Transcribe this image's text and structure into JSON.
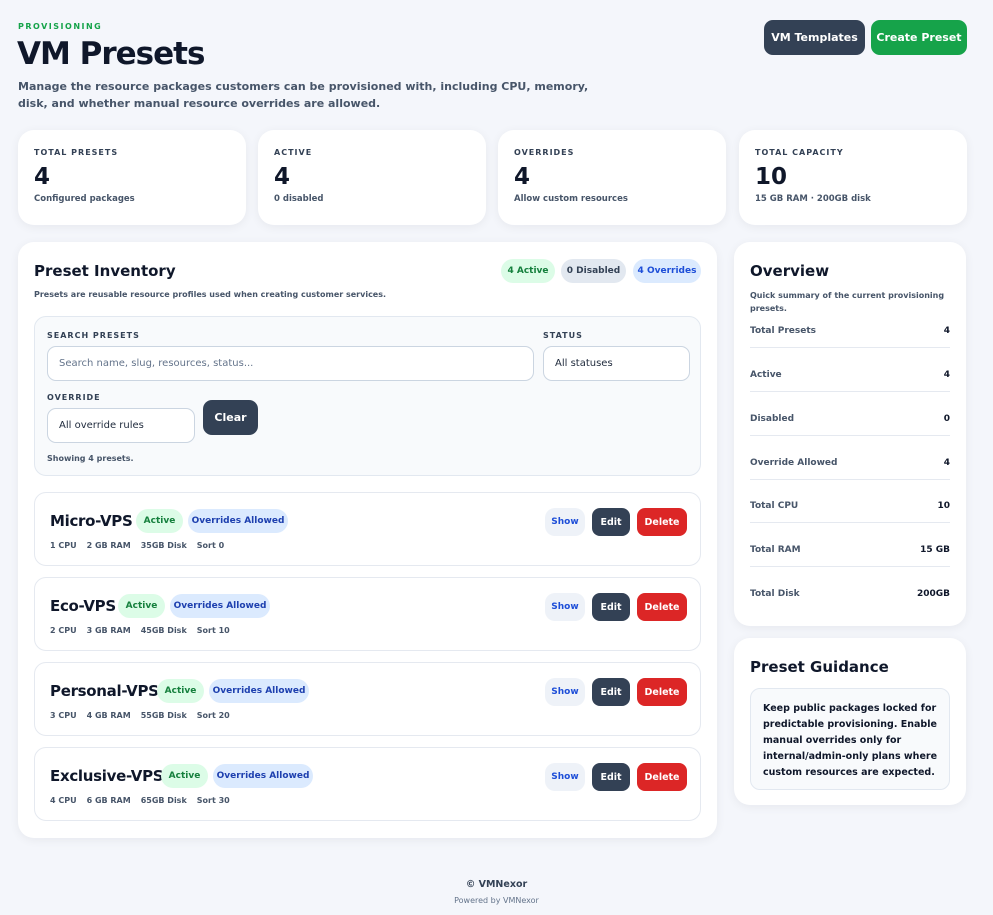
{
  "header": {
    "eyebrow": "PROVISIONING",
    "title": "VM Presets",
    "description": "Manage the resource packages customers can be provisioned with, including CPU, memory, disk, and whether manual resource overrides are allowed.",
    "templates_label": "VM Templates",
    "create_label": "Create Preset"
  },
  "stats": [
    {
      "label": "TOTAL PRESETS",
      "value": "4",
      "sub": "Configured packages"
    },
    {
      "label": "ACTIVE",
      "value": "4",
      "sub": "0 disabled"
    },
    {
      "label": "OVERRIDES",
      "value": "4",
      "sub": "Allow custom resources"
    },
    {
      "label": "TOTAL CAPACITY",
      "value": "10",
      "sub": "15 GB RAM · 200GB disk"
    }
  ],
  "inventory": {
    "title": "Preset Inventory",
    "subtitle": "Presets are reusable resource profiles used when creating customer services.",
    "badges": {
      "active": "4 Active",
      "disabled": "0 Disabled",
      "overrides": "4 Overrides"
    },
    "filters": {
      "search_label": "SEARCH PRESETS",
      "search_placeholder": "Search name, slug, resources, status...",
      "status_label": "STATUS",
      "status_value": "All statuses",
      "override_label": "OVERRIDE",
      "override_value": "All override rules",
      "clear_label": "Clear",
      "showing": "Showing 4 presets."
    },
    "presets": [
      {
        "name": "Micro-VPS",
        "status": "Active",
        "override": "Overrides Allowed",
        "cpu": "1 CPU",
        "ram": "2 GB RAM",
        "disk": "35GB Disk",
        "sort": "Sort 0"
      },
      {
        "name": "Eco-VPS",
        "status": "Active",
        "override": "Overrides Allowed",
        "cpu": "2 CPU",
        "ram": "3 GB RAM",
        "disk": "45GB Disk",
        "sort": "Sort 10"
      },
      {
        "name": "Personal-VPS",
        "status": "Active",
        "override": "Overrides Allowed",
        "cpu": "3 CPU",
        "ram": "4 GB RAM",
        "disk": "55GB Disk",
        "sort": "Sort 20"
      },
      {
        "name": "Exclusive-VPS",
        "status": "Active",
        "override": "Overrides Allowed",
        "cpu": "4 CPU",
        "ram": "6 GB RAM",
        "disk": "65GB Disk",
        "sort": "Sort 30"
      }
    ],
    "actions": {
      "show": "Show",
      "edit": "Edit",
      "delete": "Delete"
    }
  },
  "overview": {
    "title": "Overview",
    "subtitle": "Quick summary of the current provisioning presets.",
    "rows": [
      {
        "key": "Total Presets",
        "value": "4"
      },
      {
        "key": "Active",
        "value": "4"
      },
      {
        "key": "Disabled",
        "value": "0"
      },
      {
        "key": "Override Allowed",
        "value": "4"
      },
      {
        "key": "Total CPU",
        "value": "10"
      },
      {
        "key": "Total RAM",
        "value": "15 GB"
      },
      {
        "key": "Total Disk",
        "value": "200GB"
      }
    ]
  },
  "guidance": {
    "title": "Preset Guidance",
    "text": "Keep public packages locked for predictable provisioning. Enable manual overrides only for internal/admin-only plans where custom resources are expected."
  },
  "footer": {
    "copyright": "© VMNexor",
    "powered": "Powered by VMNexor"
  }
}
